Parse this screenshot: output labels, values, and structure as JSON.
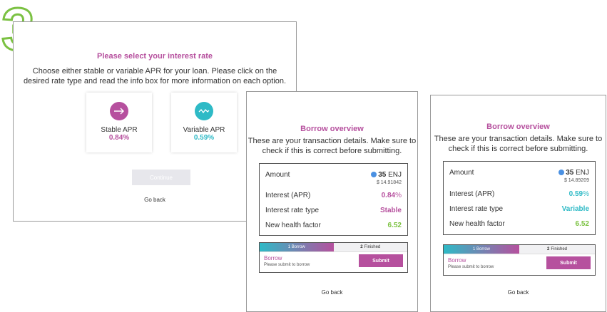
{
  "step_number": "3",
  "colors": {
    "brand_purple": "#b6509e",
    "brand_teal": "#2ebac6",
    "green": "#7cc242",
    "step_green": "#7bc142"
  },
  "rate_select": {
    "title": "Please select your interest rate",
    "description_line1": "Choose either stable or variable APR for your loan. Please click on the",
    "description_line2": "desired rate type and read the info box for more information on each option.",
    "options": [
      {
        "label": "Stable APR",
        "value": "0.84",
        "unit": "%",
        "icon": "arrow-right-icon"
      },
      {
        "label": "Variable APR",
        "value": "0.59",
        "unit": "%",
        "icon": "wave-icon"
      }
    ],
    "continue_label": "Continue",
    "go_back_label": "Go back"
  },
  "overviews": [
    {
      "title": "Borrow overview",
      "description_line1": "These are your transaction details. Make sure to",
      "description_line2": "check if this is correct before submitting.",
      "amount_label": "Amount",
      "amount_value": "35",
      "amount_unit": "ENJ",
      "amount_usd": "$ 14.91842",
      "interest_label": "Interest (APR)",
      "interest_value": "0.84",
      "interest_unit": "%",
      "rate_type_label": "Interest rate type",
      "rate_type_value": "Stable",
      "health_label": "New health factor",
      "health_value": "6.52",
      "tab1_num": "1",
      "tab1_label": "Borrow",
      "tab2_num": "2",
      "tab2_label": "Finished",
      "borrow_label": "Borrow",
      "borrow_sub": "Please submit to borrow",
      "submit_label": "Submit",
      "go_back_label": "Go back"
    },
    {
      "title": "Borrow overview",
      "description_line1": "These are your transaction details. Make sure to",
      "description_line2": "check if this is correct before submitting.",
      "amount_label": "Amount",
      "amount_value": "35",
      "amount_unit": "ENJ",
      "amount_usd": "$ 14.89209",
      "interest_label": "Interest (APR)",
      "interest_value": "0.59",
      "interest_unit": "%",
      "rate_type_label": "Interest rate type",
      "rate_type_value": "Variable",
      "health_label": "New health factor",
      "health_value": "6.52",
      "tab1_num": "1",
      "tab1_label": "Borrow",
      "tab2_num": "2",
      "tab2_label": "Finished",
      "borrow_label": "Borrow",
      "borrow_sub": "Please submit to borrow",
      "submit_label": "Submit",
      "go_back_label": "Go back"
    }
  ]
}
